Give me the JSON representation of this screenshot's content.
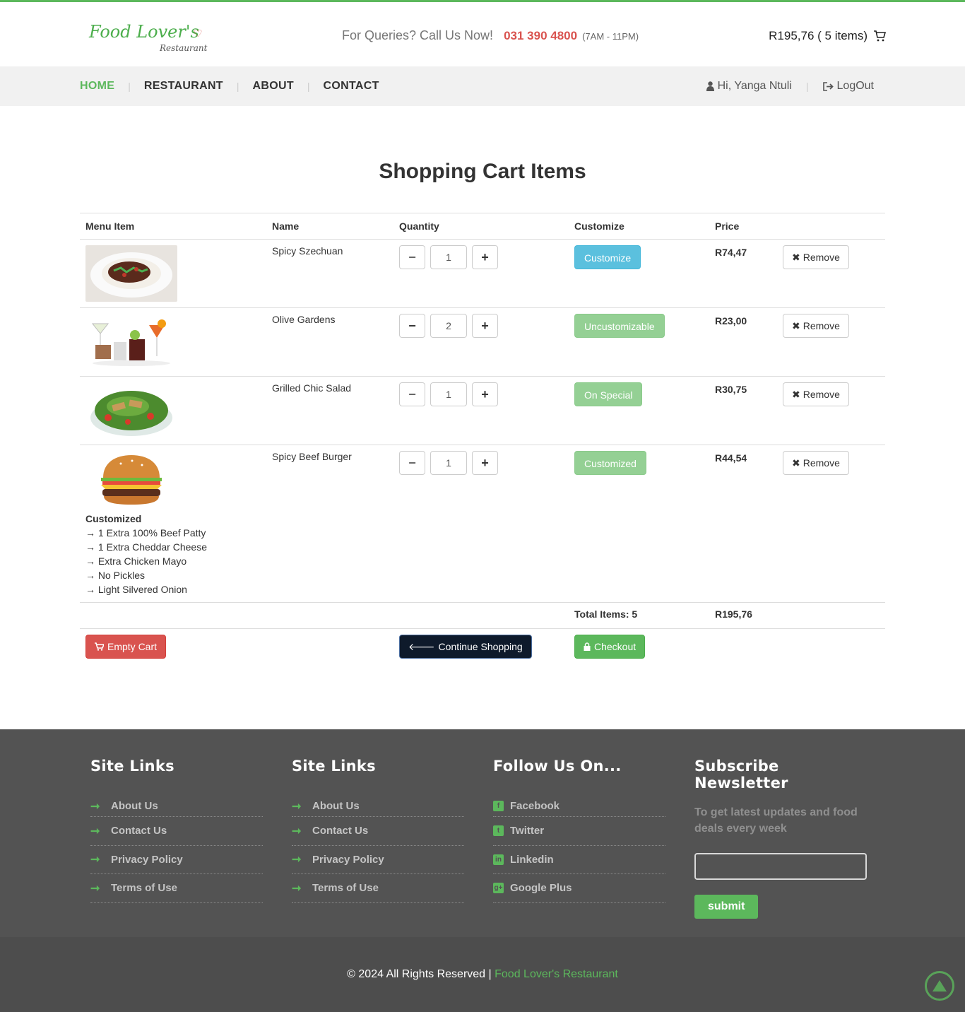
{
  "header": {
    "logo_main": "Food Lover's",
    "logo_sub": "Restaurant",
    "queries_label": "For Queries? Call Us Now!",
    "phone": "031 390 4800",
    "hours": "(7AM - 11PM)",
    "cart_summary": "R195,76 ( 5 items)"
  },
  "nav": {
    "items": [
      {
        "label": "HOME"
      },
      {
        "label": "RESTAURANT"
      },
      {
        "label": "ABOUT"
      },
      {
        "label": "CONTACT"
      }
    ],
    "user_greeting": "Hi, Yanga Ntuli",
    "logout_label": "LogOut"
  },
  "page_title": "Shopping Cart Items",
  "cart": {
    "columns": [
      "Menu Item",
      "Name",
      "Quantity",
      "Customize",
      "Price"
    ],
    "items": [
      {
        "name": "Spicy Szechuan",
        "qty": "1",
        "customize_label": "Customize",
        "price": "R74,47",
        "remove_label": "Remove"
      },
      {
        "name": "Olive Gardens",
        "qty": "2",
        "customize_label": "Uncustomizable",
        "price": "R23,00",
        "remove_label": "Remove"
      },
      {
        "name": "Grilled Chic Salad",
        "qty": "1",
        "customize_label": "On Special",
        "price": "R30,75",
        "remove_label": "Remove"
      },
      {
        "name": "Spicy Beef Burger",
        "qty": "1",
        "customize_label": "Customized",
        "price": "R44,54",
        "remove_label": "Remove",
        "custom_title": "Customized",
        "custom_options": [
          "→ 1 Extra 100% Beef Patty",
          "→ 1 Extra Cheddar Cheese",
          "→ Extra Chicken Mayo",
          "→ No Pickles",
          "→ Light Silvered Onion"
        ]
      }
    ],
    "total_items_label": "Total Items: 5",
    "total_price": "R195,76",
    "empty_cart_label": "Empty Cart",
    "continue_label": "Continue Shopping",
    "checkout_label": "Checkout"
  },
  "footer": {
    "col1_title": "Site Links",
    "col1_links": [
      "About Us",
      "Contact Us",
      "Privacy Policy",
      "Terms of Use"
    ],
    "col2_title": "Site Links",
    "col2_links": [
      "About Us",
      "Contact Us",
      "Privacy Policy",
      "Terms of Use"
    ],
    "col3_title": "Follow Us On...",
    "col3_links": [
      "Facebook",
      "Twitter",
      "Linkedin",
      "Google Plus"
    ],
    "col4_title": "Subscribe Newsletter",
    "subscribe_text": "To get latest updates and food deals every week",
    "subscribe_button": "submit"
  },
  "copyright": {
    "text": "© 2024 All Rights Reserved |",
    "brand": "Food Lover's Restaurant"
  },
  "colors": {
    "accent": "#5cb85c",
    "danger": "#d9534f",
    "info": "#5bc0de",
    "footer": "#535353"
  }
}
